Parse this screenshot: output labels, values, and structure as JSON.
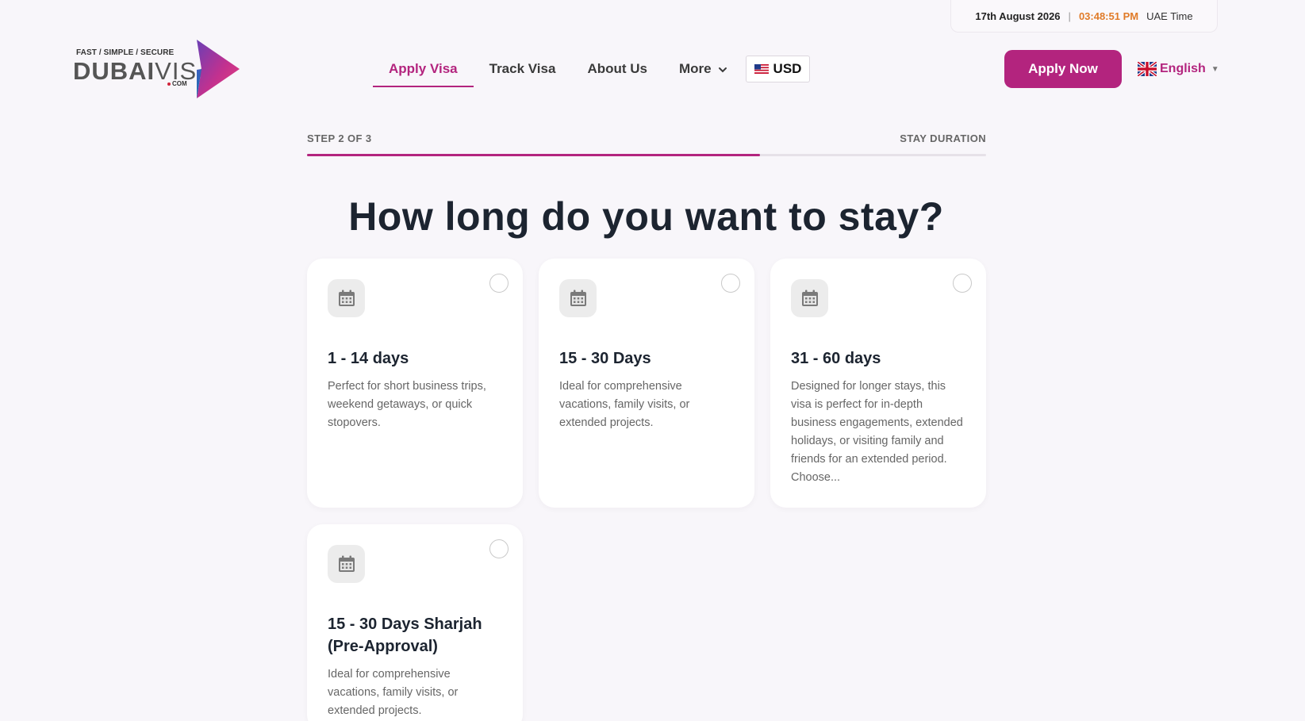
{
  "topbar": {
    "date": "17th August 2026",
    "separator": "|",
    "time": "03:48:51 PM",
    "zone": "UAE Time"
  },
  "logo": {
    "tagline": "FAST / SIMPLE / SECURE",
    "word_bold": "DUBAI",
    "word_thin": "VISA",
    "dotcom": "COM"
  },
  "nav": {
    "items": [
      "Apply Visa",
      "Track Visa",
      "About Us",
      "More"
    ],
    "currency": "USD",
    "apply_now": "Apply Now",
    "language": "English"
  },
  "progress": {
    "step_label": "STEP 2 OF 3",
    "step_name": "STAY DURATION",
    "fraction": 0.667
  },
  "heading": "How long do you want to stay?",
  "options": [
    {
      "title": "1 - 14 days",
      "description": "Perfect for short business trips, weekend getaways, or quick stopovers."
    },
    {
      "title": "15 - 30 Days",
      "description": "Ideal for comprehensive vacations, family visits, or extended projects."
    },
    {
      "title": "31 - 60 days",
      "description": "Designed for longer stays, this visa is perfect for in-depth business engagements, extended holidays, or visiting family and friends for an extended period. Choose..."
    },
    {
      "title": "15 - 30 Days Sharjah (Pre-Approval)",
      "description": "Ideal for comprehensive vacations, family visits, or extended projects."
    }
  ],
  "colors": {
    "accent": "#b3247e",
    "clock": "#e07b28",
    "background": "#f8f6fa"
  },
  "icons": {
    "option": "calendar-icon",
    "more": "chevron-down-icon",
    "currency_flag": "us-flag-icon",
    "language_flag": "uk-flag-icon"
  }
}
